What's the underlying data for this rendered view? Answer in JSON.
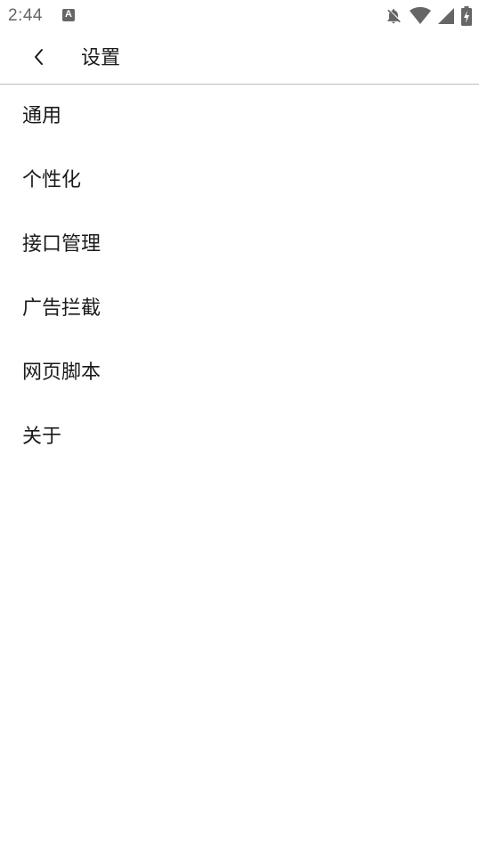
{
  "status_bar": {
    "time": "2:44",
    "notification_icon": "a-badge-icon",
    "notification_letter": "A",
    "icons": [
      "bell-off-icon",
      "wifi-icon",
      "cellular-signal-icon",
      "battery-charging-icon"
    ]
  },
  "app_bar": {
    "back_icon": "chevron-left-icon",
    "title": "设置"
  },
  "settings": {
    "items": [
      {
        "label": "通用"
      },
      {
        "label": "个性化"
      },
      {
        "label": "接口管理"
      },
      {
        "label": "广告拦截"
      },
      {
        "label": "网页脚本"
      },
      {
        "label": "关于"
      }
    ]
  },
  "colors": {
    "text": "#1a1a1a",
    "status_icons": "#666666",
    "divider": "#bdbdbd",
    "background": "#ffffff"
  }
}
